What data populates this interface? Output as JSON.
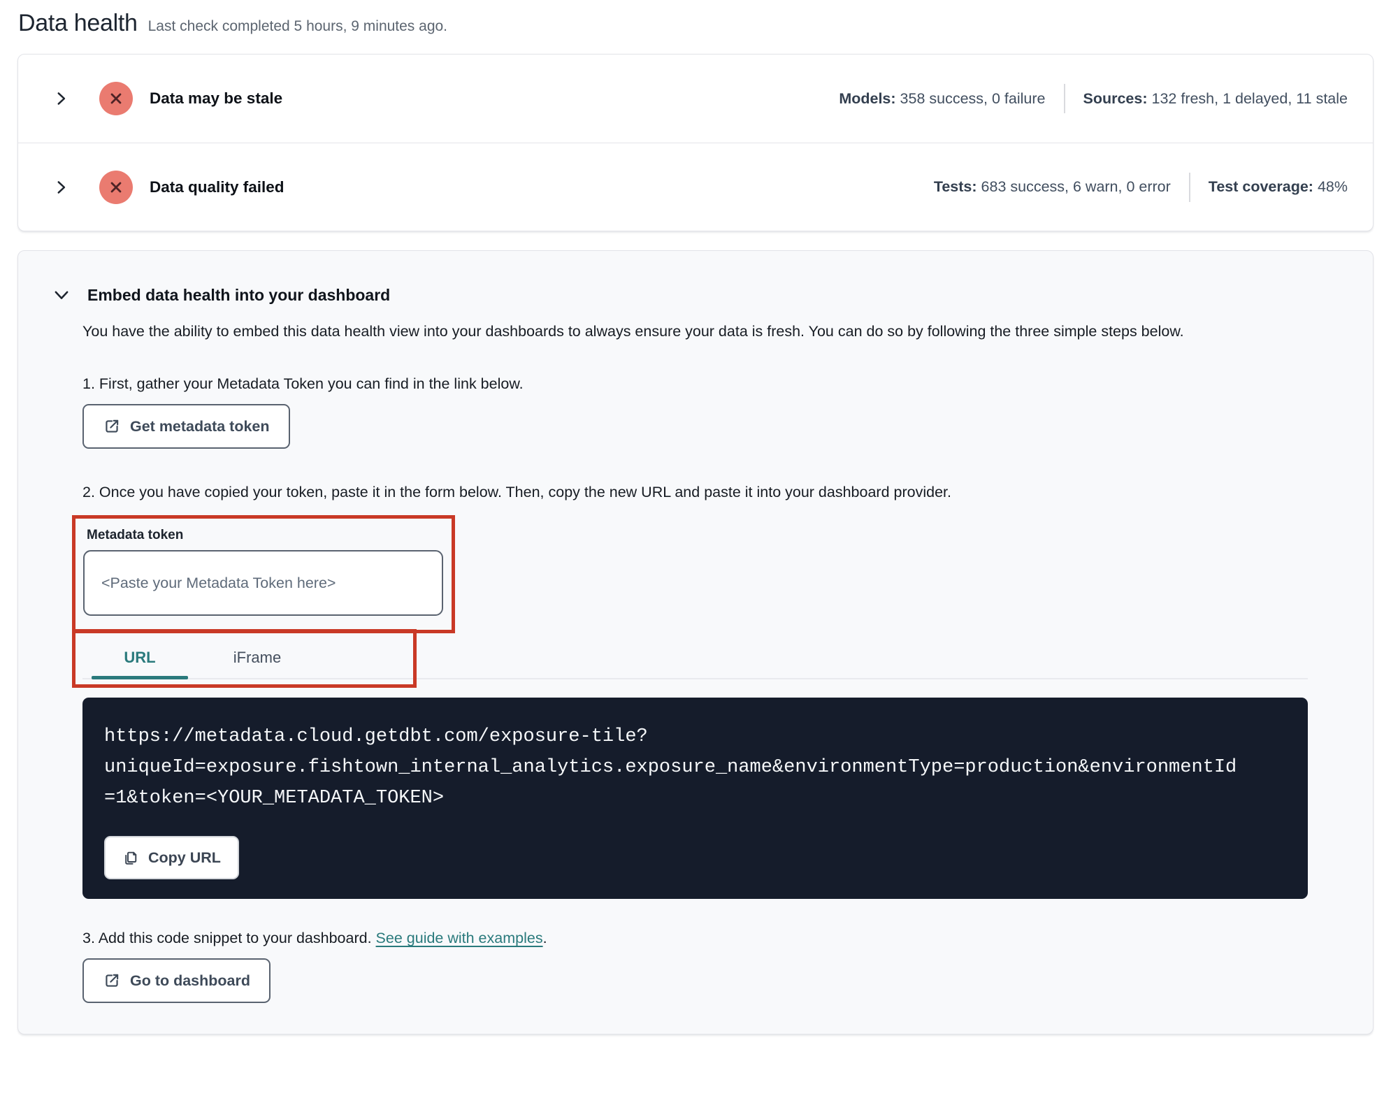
{
  "page": {
    "title": "Data health",
    "subtitle": "Last check completed 5 hours, 9 minutes ago."
  },
  "status_rows": [
    {
      "title": "Data may be stale",
      "stats": [
        {
          "label": "Models:",
          "value": "358 success, 0 failure"
        },
        {
          "label": "Sources:",
          "value": "132 fresh, 1 delayed, 11 stale"
        }
      ]
    },
    {
      "title": "Data quality failed",
      "stats": [
        {
          "label": "Tests:",
          "value": "683 success, 6 warn, 0 error"
        },
        {
          "label": "Test coverage:",
          "value": "48%"
        }
      ]
    }
  ],
  "embed": {
    "title": "Embed data health into your dashboard",
    "description": "You have the ability to embed this data health view into your dashboards to always ensure your data is fresh. You can do so by following the three simple steps below.",
    "step1": "1. First, gather your Metadata Token you can find in the link below.",
    "get_token_button": "Get metadata token",
    "step2": "2. Once you have copied your token, paste it in the form below. Then, copy the new URL and paste it into your dashboard provider.",
    "token_label": "Metadata token",
    "token_placeholder": "<Paste your Metadata Token here>",
    "tabs": [
      {
        "label": "URL",
        "active": true
      },
      {
        "label": "iFrame",
        "active": false
      }
    ],
    "code_lines": {
      "0": "https://metadata.cloud.getdbt.com/exposure-tile?",
      "1": "uniqueId=exposure.fishtown_internal_analytics.exposure_name&environmentType=production&environmentId",
      "2": "=1&token=<YOUR_METADATA_TOKEN>"
    },
    "copy_button": "Copy URL",
    "step3_prefix": "3. Add this code snippet to your dashboard. ",
    "step3_link": "See guide with examples",
    "step3_suffix": ".",
    "dashboard_button": "Go to dashboard"
  },
  "colors": {
    "accent_teal": "#2a7a7c",
    "error_icon_bg": "#ea7b70",
    "error_icon_x": "#4e2326",
    "annotation_red": "#c93926",
    "code_background": "#151c2b"
  }
}
